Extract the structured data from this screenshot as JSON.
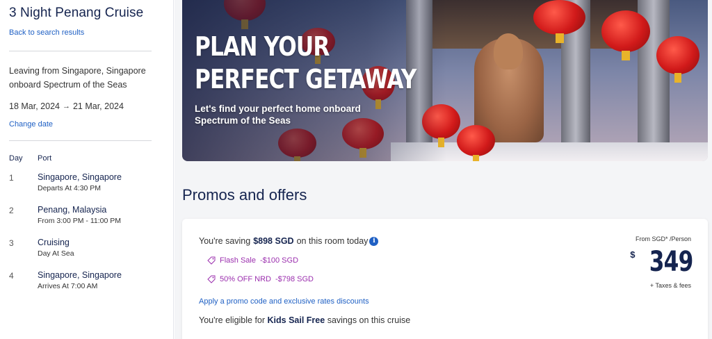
{
  "sidebar": {
    "title": "3 Night Penang Cruise",
    "back_link": "Back to search results",
    "leaving": "Leaving from Singapore, Singapore onboard Spectrum of the Seas",
    "date_from": "18 Mar, 2024",
    "date_to": "21 Mar, 2024",
    "change_date": "Change date",
    "col_day": "Day",
    "col_port": "Port",
    "itinerary": [
      {
        "day": "1",
        "port": "Singapore, Singapore",
        "detail": "Departs At 4:30 PM"
      },
      {
        "day": "2",
        "port": "Penang, Malaysia",
        "detail": "From 3:00 PM - 11:00 PM"
      },
      {
        "day": "3",
        "port": "Cruising",
        "detail": "Day At Sea"
      },
      {
        "day": "4",
        "port": "Singapore, Singapore",
        "detail": "Arrives At 7:00 AM"
      }
    ]
  },
  "hero": {
    "headline_1": "PLAN YOUR",
    "headline_2": "PERFECT GETAWAY",
    "subtext": "Let's find your perfect home onboard Spectrum of the Seas"
  },
  "promos": {
    "title": "Promos and offers",
    "saving_prefix": "You're saving",
    "saving_amount": "$898 SGD",
    "saving_suffix": "on this room today",
    "offers": [
      {
        "name": "Flash Sale",
        "amount": "-$100 SGD"
      },
      {
        "name": "50% OFF NRD",
        "amount": "-$798 SGD"
      }
    ],
    "apply_link": "Apply a promo code and exclusive rates discounts",
    "kids_prefix": "You're eligible for",
    "kids_bold": "Kids Sail Free",
    "kids_suffix": "savings on this cruise",
    "price_from": "From SGD* /Person",
    "price_currency": "$",
    "price_value": "349",
    "price_note": "+ Taxes & fees"
  },
  "colors": {
    "brand_navy": "#15244f",
    "link_blue": "#1f60c4",
    "promo_purple": "#9b2fae"
  }
}
